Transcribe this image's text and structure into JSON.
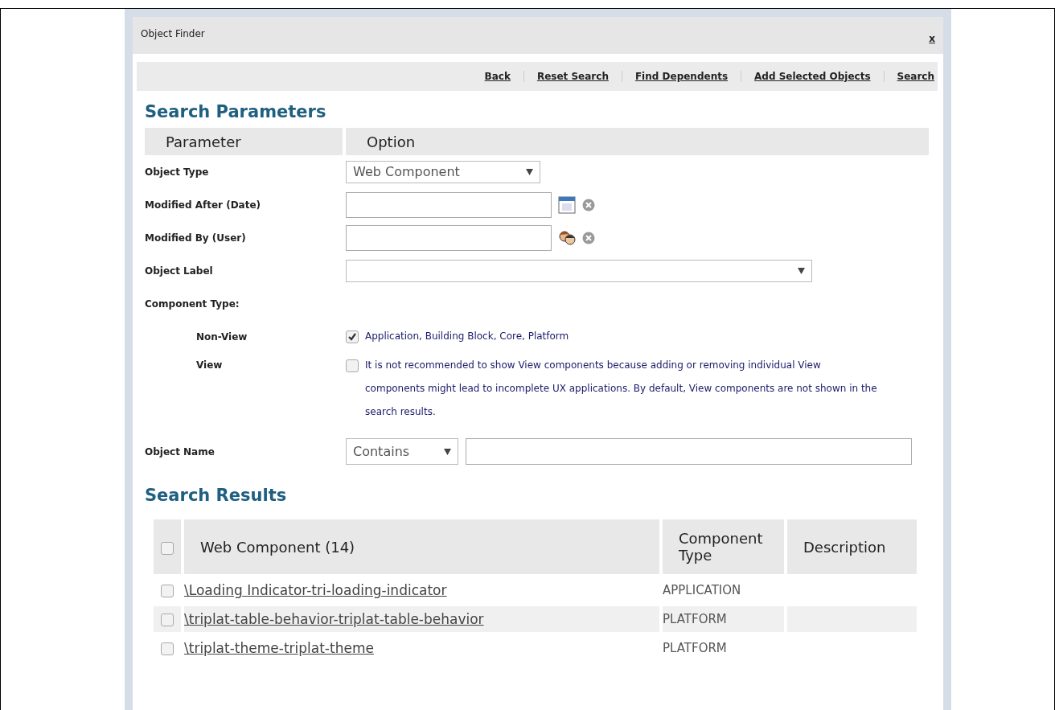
{
  "dialog": {
    "title": "Object Finder",
    "close": "x"
  },
  "toolbar": {
    "links": [
      "Back",
      "Reset Search",
      "Find Dependents",
      "Add Selected Objects",
      "Search"
    ]
  },
  "search_parameters": {
    "heading": "Search Parameters",
    "columns": [
      "Parameter",
      "Option"
    ],
    "object_type": {
      "label": "Object Type",
      "value": "Web Component"
    },
    "modified_after": {
      "label": "Modified After (Date)"
    },
    "modified_by": {
      "label": "Modified By (User)"
    },
    "object_label": {
      "label": "Object Label"
    },
    "component_type": {
      "label": "Component Type:",
      "options": [
        {
          "label": "Non-View",
          "checked": true,
          "text": "Application, Building Block, Core, Platform"
        },
        {
          "label": "View",
          "checked": false,
          "text": "It is not recommended to show View components because adding or removing individual View components might lead to incomplete UX applications. By default, View components are not shown in the search results."
        }
      ]
    },
    "object_name": {
      "label": "Object Name",
      "operator": "Contains"
    }
  },
  "search_results": {
    "heading": "Search Results",
    "select_all_checked": false,
    "columns": [
      "Web Component (14)",
      "Component Type",
      "Description"
    ],
    "rows": [
      {
        "checked": false,
        "name": "\\Loading Indicator-tri-loading-indicator",
        "type": "APPLICATION"
      },
      {
        "checked": false,
        "name": "\\triplat-table-behavior-triplat-table-behavior",
        "type": "PLATFORM"
      },
      {
        "checked": false,
        "name": "\\triplat-theme-triplat-theme",
        "type": "PLATFORM"
      }
    ]
  }
}
